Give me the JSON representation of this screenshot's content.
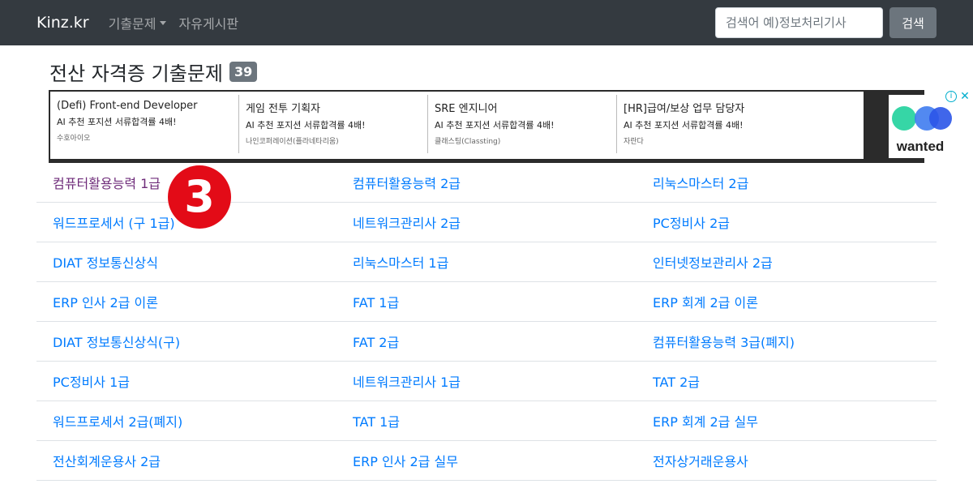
{
  "navbar": {
    "brand": "Kinz.kr",
    "menu_exam": "기출문제",
    "menu_board": "자유게시판",
    "search_placeholder": "검색어 예)정보처리기사",
    "search_button": "검색"
  },
  "page": {
    "title": "전산 자격증 기출문제",
    "count": "39"
  },
  "ad": {
    "items": [
      {
        "title": "(Defi) Front-end Developer",
        "desc": "AI 추천 포지션 서류합격률 4배!",
        "company": "수호아이오"
      },
      {
        "title": "게임 전투 기획자",
        "desc": "AI 추천 포지션 서류합격률 4배!",
        "company": "나인코퍼레이션(플라네타리움)"
      },
      {
        "title": "SRE 엔지니어",
        "desc": "AI 추천 포지션 서류합격률 4배!",
        "company": "클래스팅(Classting)"
      },
      {
        "title": "[HR]급여/보상 업무 담당자",
        "desc": "AI 추천 포지션 서류합격률 4배!",
        "company": "자란다"
      }
    ],
    "logo_text": "wanted",
    "logo_colors": [
      "#36d6a6",
      "#3f7cf0",
      "#2b55e8"
    ]
  },
  "exams": {
    "rows": [
      [
        "컴퓨터활용능력 1급",
        "컴퓨터활용능력 2급",
        "리눅스마스터 2급"
      ],
      [
        "워드프로세서 (구 1급)",
        "네트워크관리사 2급",
        "PC정비사 2급"
      ],
      [
        "DIAT 정보통신상식",
        "리눅스마스터 1급",
        "인터넷정보관리사 2급"
      ],
      [
        "ERP 인사 2급 이론",
        "FAT 1급",
        "ERP 회계 2급 이론"
      ],
      [
        "DIAT 정보통신상식(구)",
        "FAT 2급",
        "컴퓨터활용능력 3급(폐지)"
      ],
      [
        "PC정비사 1급",
        "네트워크관리사 1급",
        "TAT 2급"
      ],
      [
        "워드프로세서 2급(폐지)",
        "TAT 1급",
        "ERP 회계 2급 실무"
      ],
      [
        "전산회계운용사 2급",
        "ERP 인사 2급 실무",
        "전자상거래운용사"
      ]
    ]
  },
  "marker": {
    "label": "3",
    "color": "#e30b17"
  },
  "colors": {
    "link": "#007bff",
    "visited": "#6f2c7a",
    "navbar": "#343a40"
  }
}
